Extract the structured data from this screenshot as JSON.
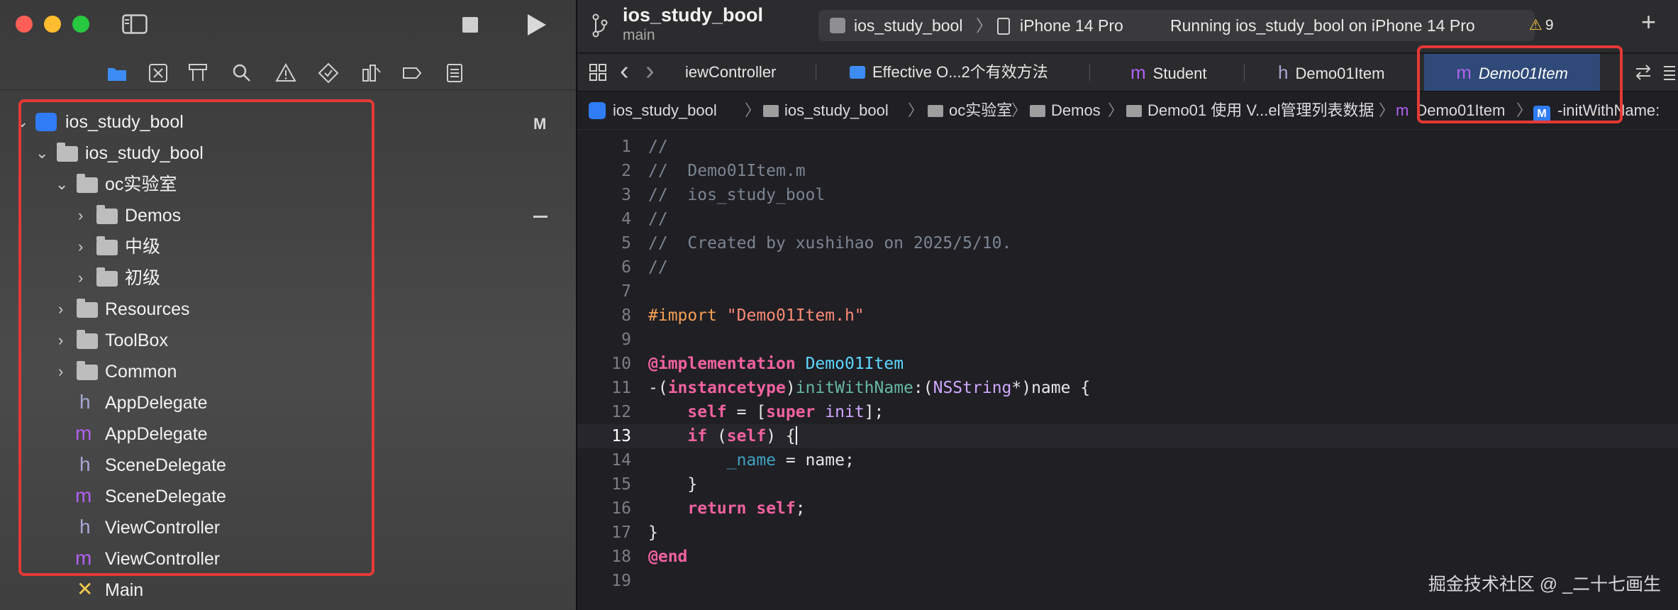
{
  "navigator": {
    "tree": [
      {
        "label": "ios_study_bool",
        "type": "project",
        "expanded": true
      },
      {
        "label": "ios_study_bool",
        "type": "folder",
        "expanded": true
      },
      {
        "label": "oc实验室",
        "type": "folder",
        "expanded": true
      },
      {
        "label": "Demos",
        "type": "folder",
        "expanded": false
      },
      {
        "label": "中级",
        "type": "folder",
        "expanded": false
      },
      {
        "label": "初级",
        "type": "folder",
        "expanded": false
      },
      {
        "label": "Resources",
        "type": "folder",
        "expanded": false
      },
      {
        "label": "ToolBox",
        "type": "folder",
        "expanded": false
      },
      {
        "label": "Common",
        "type": "folder",
        "expanded": false
      },
      {
        "label": "AppDelegate",
        "type": "h"
      },
      {
        "label": "AppDelegate",
        "type": "m"
      },
      {
        "label": "SceneDelegate",
        "type": "h"
      },
      {
        "label": "SceneDelegate",
        "type": "m"
      },
      {
        "label": "ViewController",
        "type": "h"
      },
      {
        "label": "ViewController",
        "type": "m"
      },
      {
        "label": "Main",
        "type": "storyboard"
      }
    ],
    "modified_badge": "M",
    "glyphs": {
      "h": "h",
      "m": "m",
      "storyboard": "✕",
      "chevron_open": "⌄",
      "chevron_closed": "›"
    }
  },
  "toolbar": {
    "project_name": "ios_study_bool",
    "branch": "main",
    "scheme": "ios_study_bool",
    "scheme_sep": "〉",
    "device": "iPhone 14 Pro",
    "status": "Running ios_study_bool on iPhone 14 Pro",
    "warning_icon": "⚠",
    "warnings": "9",
    "add_icon": "+"
  },
  "tabs": [
    {
      "label": "iewController",
      "type": "m"
    },
    {
      "label": "Effective O...2个有效方法",
      "type": "image"
    },
    {
      "label": "Student",
      "type": "m"
    },
    {
      "label": "Demo01Item",
      "type": "h"
    },
    {
      "label": "Demo01Item",
      "type": "m",
      "active": true
    }
  ],
  "tab_glyphs": {
    "m": "m",
    "h": "h",
    "back": "‹",
    "forward": "›"
  },
  "breadcrumb": [
    {
      "label": "ios_study_bool",
      "type": "project"
    },
    {
      "label": "ios_study_bool",
      "type": "folder"
    },
    {
      "label": "oc实验室",
      "type": "folder"
    },
    {
      "label": "Demos",
      "type": "folder"
    },
    {
      "label": "Demo01 使用 V...el管理列表数据",
      "type": "folder"
    },
    {
      "label": "Demo01Item",
      "type": "m"
    },
    {
      "label": "-initWithName:",
      "type": "method",
      "badge": "M"
    }
  ],
  "breadcrumb_sep": "〉",
  "code": {
    "current_line": 13,
    "lines": [
      {
        "n": "1",
        "t": [
          [
            "cm",
            "//"
          ]
        ]
      },
      {
        "n": "2",
        "t": [
          [
            "cm",
            "//  Demo01Item.m"
          ]
        ]
      },
      {
        "n": "3",
        "t": [
          [
            "cm",
            "//  ios_study_bool"
          ]
        ]
      },
      {
        "n": "4",
        "t": [
          [
            "cm",
            "//"
          ]
        ]
      },
      {
        "n": "5",
        "t": [
          [
            "cm",
            "//  Created by xushihao on 2025/5/10."
          ]
        ]
      },
      {
        "n": "6",
        "t": [
          [
            "cm",
            "//"
          ]
        ]
      },
      {
        "n": "7",
        "t": []
      },
      {
        "n": "8",
        "t": [
          [
            "pp",
            "#import "
          ],
          [
            "str",
            "\"Demo01Item.h\""
          ]
        ]
      },
      {
        "n": "9",
        "t": []
      },
      {
        "n": "10",
        "t": [
          [
            "kw",
            "@implementation"
          ],
          [
            "",
            "",
            " "
          ],
          [
            "ty",
            "Demo01Item"
          ]
        ]
      },
      {
        "n": "11",
        "t": [
          [
            "",
            "-("
          ],
          [
            "kw",
            "instancetype"
          ],
          [
            "",
            ")"
          ],
          [
            "fn",
            "initWithName"
          ],
          [
            "",
            ":("
          ],
          [
            "cls",
            "NSString"
          ],
          [
            "",
            "*)name {"
          ]
        ]
      },
      {
        "n": "12",
        "t": [
          [
            "",
            "    "
          ],
          [
            "kw",
            "self"
          ],
          [
            "",
            " = ["
          ],
          [
            "kw",
            "super"
          ],
          [
            "",
            " "
          ],
          [
            "cls",
            "init"
          ],
          [
            "",
            "];"
          ]
        ]
      },
      {
        "n": "13",
        "t": [
          [
            "",
            "    "
          ],
          [
            "kw",
            "if"
          ],
          [
            "",
            " ("
          ],
          [
            "kw",
            "self"
          ],
          [
            "",
            ") {"
          ],
          [
            "caret",
            ""
          ]
        ]
      },
      {
        "n": "14",
        "t": [
          [
            "",
            "        "
          ],
          [
            "var",
            "_name"
          ],
          [
            "",
            " = name;"
          ]
        ]
      },
      {
        "n": "15",
        "t": [
          [
            "",
            "    }"
          ]
        ]
      },
      {
        "n": "16",
        "t": [
          [
            "",
            "    "
          ],
          [
            "kw",
            "return"
          ],
          [
            "",
            " "
          ],
          [
            "kw",
            "self"
          ],
          [
            "",
            ";"
          ]
        ]
      },
      {
        "n": "17",
        "t": [
          [
            "",
            "}"
          ]
        ]
      },
      {
        "n": "18",
        "t": [
          [
            "kw",
            "@end"
          ]
        ]
      },
      {
        "n": "19",
        "t": []
      }
    ]
  },
  "watermark": "掘金技术社区 @ _二十七画生",
  "colors": {
    "highlight": "#e53935",
    "accent": "#2f7cf6",
    "m_file": "#b160f0",
    "h_file": "#a7a7d6"
  }
}
